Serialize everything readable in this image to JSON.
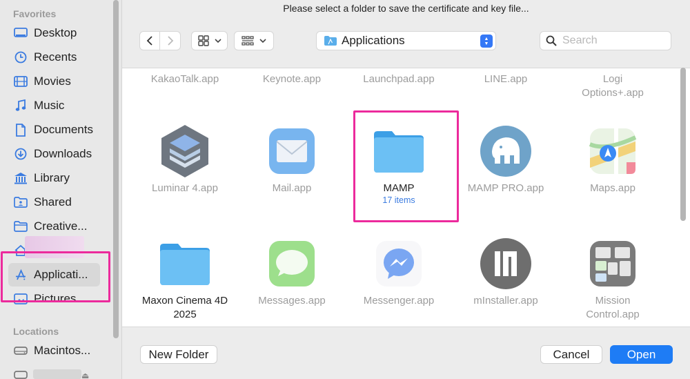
{
  "sidebar": {
    "favorites_label": "Favorites",
    "locations_label": "Locations",
    "items": [
      {
        "label": "Desktop",
        "icon": "desktop-icon"
      },
      {
        "label": "Recents",
        "icon": "clock-icon"
      },
      {
        "label": "Movies",
        "icon": "film-icon"
      },
      {
        "label": "Music",
        "icon": "music-note-icon"
      },
      {
        "label": "Documents",
        "icon": "document-icon"
      },
      {
        "label": "Downloads",
        "icon": "download-icon"
      },
      {
        "label": "Library",
        "icon": "library-icon"
      },
      {
        "label": "Shared",
        "icon": "shared-folder-icon"
      },
      {
        "label": "Creative...",
        "icon": "folder-icon"
      },
      {
        "label": "",
        "icon": "home-icon"
      },
      {
        "label": "Applicati...",
        "icon": "applications-icon"
      },
      {
        "label": "Pictures",
        "icon": "pictures-icon"
      }
    ],
    "locations": [
      {
        "label": "Macintos...",
        "icon": "disk-icon"
      }
    ]
  },
  "dialog": {
    "title": "Please select a folder to save the certificate and key file..."
  },
  "toolbar": {
    "location": "Applications",
    "search_placeholder": "Search"
  },
  "files": {
    "row1": [
      "KakaoTalk.app",
      "Keynote.app",
      "Launchpad.app",
      "LINE.app",
      "Logi Options+.app"
    ],
    "row2": [
      {
        "label": "Luminar 4.app"
      },
      {
        "label": "Mail.app"
      },
      {
        "label": "MAMP",
        "sub": "17 items"
      },
      {
        "label": "MAMP PRO.app"
      },
      {
        "label": "Maps.app"
      }
    ],
    "row3": [
      {
        "label": "Maxon Cinema 4D 2025"
      },
      {
        "label": "Messages.app"
      },
      {
        "label": "Messenger.app"
      },
      {
        "label": "mInstaller.app"
      },
      {
        "label": "Mission Control.app"
      }
    ]
  },
  "buttons": {
    "new_folder": "New Folder",
    "cancel": "Cancel",
    "open": "Open"
  },
  "colors": {
    "accent": "#1e7cf5",
    "highlight": "#ec2a9c",
    "sidebar_icon": "#3a7be0"
  }
}
